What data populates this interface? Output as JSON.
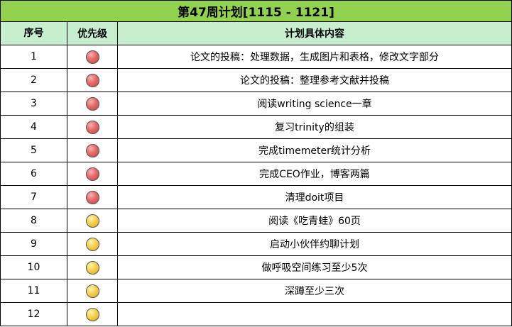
{
  "title": "第47周计划[1115 - 1121]",
  "headers": {
    "number": "序号",
    "priority": "优先级",
    "content": "计划具体内容"
  },
  "priority_colors": {
    "high": "#e46a6a",
    "medium": "#f5d04e"
  },
  "rows": [
    {
      "num": "1",
      "priority": "high",
      "task": "论文的投稿：处理数据，生成图片和表格，修改文字部分"
    },
    {
      "num": "2",
      "priority": "high",
      "task": "论文的投稿：整理参考文献并投稿"
    },
    {
      "num": "3",
      "priority": "high",
      "task": "阅读writing science一章"
    },
    {
      "num": "4",
      "priority": "high",
      "task": "复习trinity的组装"
    },
    {
      "num": "5",
      "priority": "high",
      "task": "完成timemeter统计分析"
    },
    {
      "num": "6",
      "priority": "high",
      "task": "完成CEO作业，博客两篇"
    },
    {
      "num": "7",
      "priority": "high",
      "task": "清理doit项目"
    },
    {
      "num": "8",
      "priority": "medium",
      "task": "阅读《吃青蛙》60页"
    },
    {
      "num": "9",
      "priority": "medium",
      "task": "启动小伙伴约聊计划"
    },
    {
      "num": "10",
      "priority": "medium",
      "task": "做呼吸空间练习至少5次"
    },
    {
      "num": "11",
      "priority": "medium",
      "task": "深蹲至少三次"
    },
    {
      "num": "12",
      "priority": "medium",
      "task": ""
    }
  ]
}
